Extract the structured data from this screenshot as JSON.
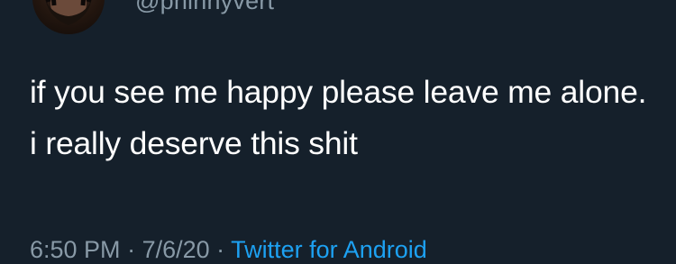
{
  "tweet": {
    "handle": "@phinnyvert",
    "text": "if you see me happy please leave me alone. i really deserve this shit",
    "meta": {
      "time": "6:50 PM",
      "separator": " · ",
      "date": "7/6/20",
      "source": "Twitter for Android"
    }
  },
  "colors": {
    "background": "#15202b",
    "text": "#ffffff",
    "secondary": "#8899a6",
    "link": "#1da1f2"
  }
}
